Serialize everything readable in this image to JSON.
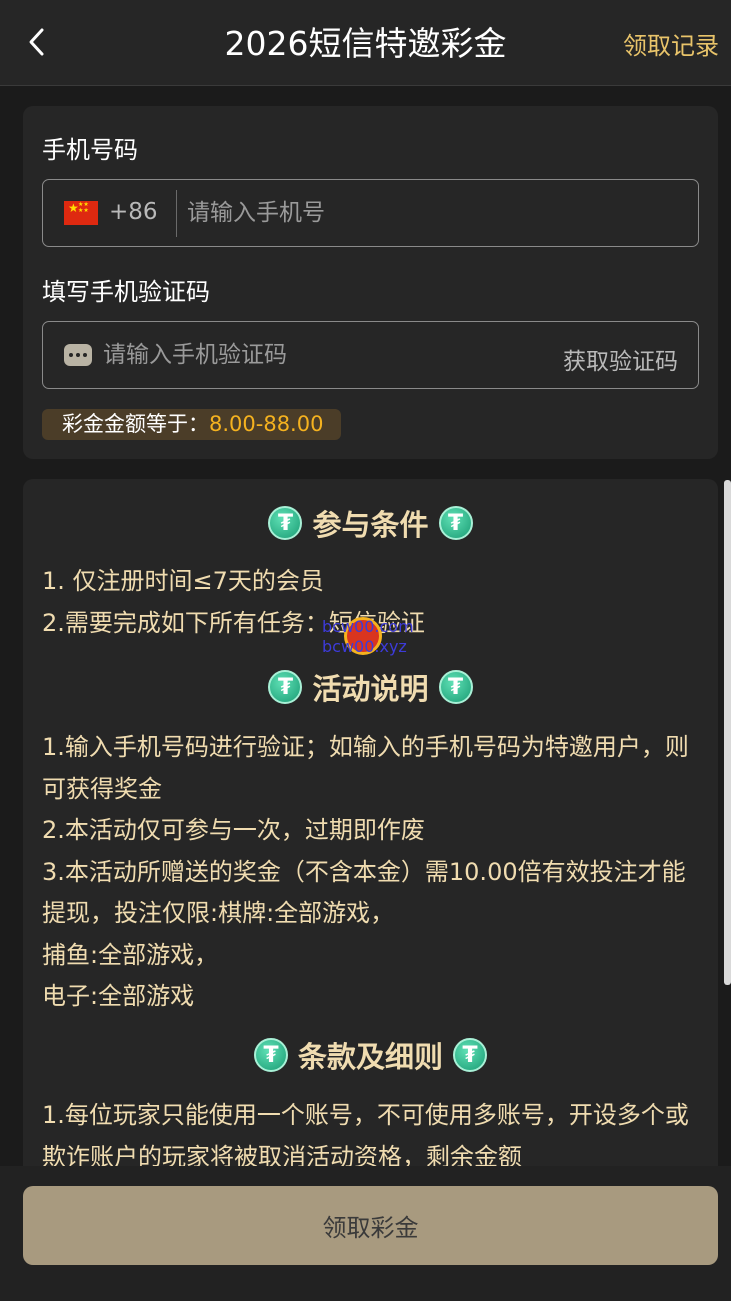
{
  "header": {
    "title": "2026短信特邀彩金",
    "records_link": "领取记录"
  },
  "form": {
    "phone_label": "手机号码",
    "country_code": "+86",
    "phone_placeholder": "请输入手机号",
    "code_label": "填写手机验证码",
    "code_placeholder": "请输入手机验证码",
    "get_code_label": "获取验证码",
    "bonus_label": "彩金金额等于：",
    "bonus_amount": "8.00-88.00"
  },
  "conditions": {
    "title": "参与条件",
    "lines": [
      "1. 仅注册时间≤7天的会员",
      "2.需要完成如下所有任务：短信验证"
    ]
  },
  "activity": {
    "title": "活动说明",
    "lines": [
      "1.输入手机号码进行验证；如输入的手机号码为特邀用户，则可获得奖金",
      "2.本活动仅可参与一次，过期即作废",
      "3.本活动所赠送的奖金（不含本金）需10.00倍有效投注才能提现，投注仅限:棋牌:全部游戏，",
      "捕鱼:全部游戏，",
      "电子:全部游戏"
    ]
  },
  "terms": {
    "title": "条款及细则",
    "lines": [
      "1.每位玩家只能使用一个账号，不可使用多账号，开设多个或欺诈账户的玩家将被取消活动资格，剩余金额"
    ]
  },
  "watermark": {
    "line1": "bcw00.com",
    "line2": "bcw00.xyz"
  },
  "footer": {
    "claim_button": "领取彩金"
  },
  "colors": {
    "accent": "#e9c46a",
    "bonus": "#f5b21f",
    "background": "#1b1b1b",
    "card": "#262626",
    "button": "#a89a7f"
  },
  "icons": {
    "back": "chevron-left-icon",
    "flag": "china-flag-icon",
    "message": "message-dots-icon",
    "coin": "tether-coin-icon"
  }
}
